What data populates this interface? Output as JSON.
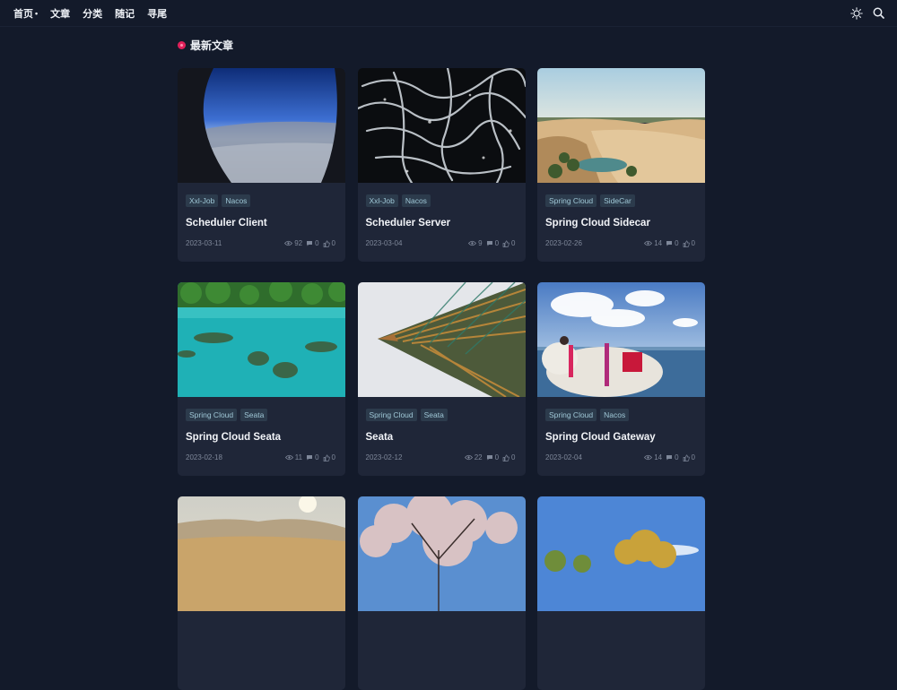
{
  "nav": {
    "items": [
      {
        "label": "首页",
        "has_dropdown": true
      },
      {
        "label": "文章"
      },
      {
        "label": "分类"
      },
      {
        "label": "随记"
      },
      {
        "label": "寻尾"
      }
    ],
    "dropdown_marker": "•"
  },
  "section": {
    "title": "最新文章"
  },
  "posts": [
    {
      "tags": [
        "Xxl-Job",
        "Nacos"
      ],
      "title": "Scheduler Client",
      "date": "2023-03-11",
      "views": "92",
      "comments": "0",
      "likes": "0"
    },
    {
      "tags": [
        "Xxl-Job",
        "Nacos"
      ],
      "title": "Scheduler Server",
      "date": "2023-03-04",
      "views": "9",
      "comments": "0",
      "likes": "0"
    },
    {
      "tags": [
        "Spring Cloud",
        "SideCar"
      ],
      "title": "Spring Cloud Sidecar",
      "date": "2023-02-26",
      "views": "14",
      "comments": "0",
      "likes": "0"
    },
    {
      "tags": [
        "Spring Cloud",
        "Seata"
      ],
      "title": "Spring Cloud Seata",
      "date": "2023-02-18",
      "views": "11",
      "comments": "0",
      "likes": "0"
    },
    {
      "tags": [
        "Spring Cloud",
        "Seata"
      ],
      "title": "Seata",
      "date": "2023-02-12",
      "views": "22",
      "comments": "0",
      "likes": "0"
    },
    {
      "tags": [
        "Spring Cloud",
        "Nacos"
      ],
      "title": "Spring Cloud Gateway",
      "date": "2023-02-04",
      "views": "14",
      "comments": "0",
      "likes": "0"
    },
    {
      "tags": [],
      "title": "",
      "date": "",
      "views": "",
      "comments": "",
      "likes": ""
    },
    {
      "tags": [],
      "title": "",
      "date": "",
      "views": "",
      "comments": "",
      "likes": ""
    },
    {
      "tags": [],
      "title": "",
      "date": "",
      "views": "",
      "comments": "",
      "likes": ""
    }
  ],
  "icons": {
    "theme": "sun-icon",
    "search": "search-icon",
    "views": "eye-icon",
    "comments": "comment-icon",
    "likes": "thumbs-up-icon"
  },
  "colors": {
    "background": "#131a2a",
    "card": "#1f2638",
    "accent": "#e0205a",
    "tag_bg": "#2c3b4c",
    "tag_text": "#9fc7d6"
  }
}
